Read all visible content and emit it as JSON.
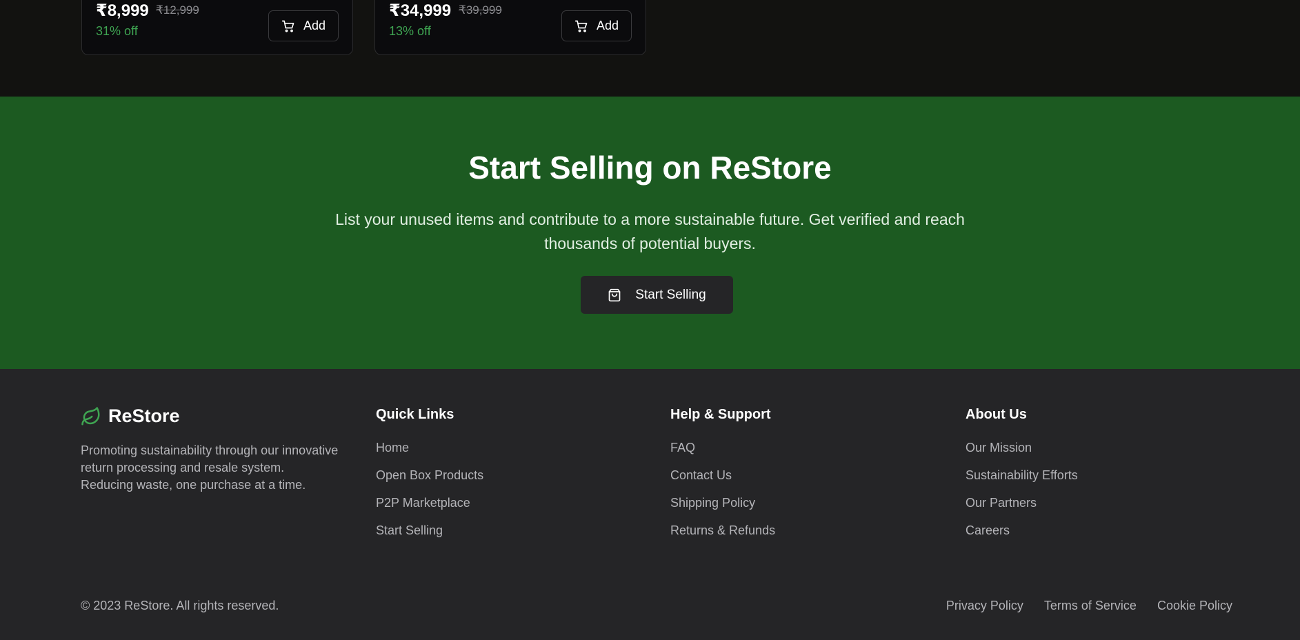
{
  "products": [
    {
      "price": "₹8,999",
      "old_price": "₹12,999",
      "discount": "31% off",
      "add_label": "Add"
    },
    {
      "price": "₹34,999",
      "old_price": "₹39,999",
      "discount": "13% off",
      "add_label": "Add"
    }
  ],
  "cta": {
    "title": "Start Selling on ReStore",
    "description": "List your unused items and contribute to a more sustainable future. Get verified and reach thousands of potential buyers.",
    "button_label": "Start Selling",
    "button_icon": "shopping-bag-icon"
  },
  "footer": {
    "brand_name": "ReStore",
    "brand_icon": "leaf-icon",
    "brand_description": "Promoting sustainability through our innovative return processing and resale system. Reducing waste, one purchase at a time.",
    "quick_links": {
      "title": "Quick Links",
      "items": [
        "Home",
        "Open Box Products",
        "P2P Marketplace",
        "Start Selling"
      ]
    },
    "help_support": {
      "title": "Help & Support",
      "items": [
        "FAQ",
        "Contact Us",
        "Shipping Policy",
        "Returns & Refunds"
      ]
    },
    "about_us": {
      "title": "About Us",
      "items": [
        "Our Mission",
        "Sustainability Efforts",
        "Our Partners",
        "Careers"
      ]
    },
    "copyright": "© 2023 ReStore. All rights reserved.",
    "legal_links": [
      "Privacy Policy",
      "Terms of Service",
      "Cookie Policy"
    ]
  },
  "colors": {
    "accent_green": "#1c5a21",
    "discount_green": "#3fa552",
    "leaf_green": "#3fa552",
    "footer_bg": "#252527",
    "products_bg": "#121210"
  }
}
